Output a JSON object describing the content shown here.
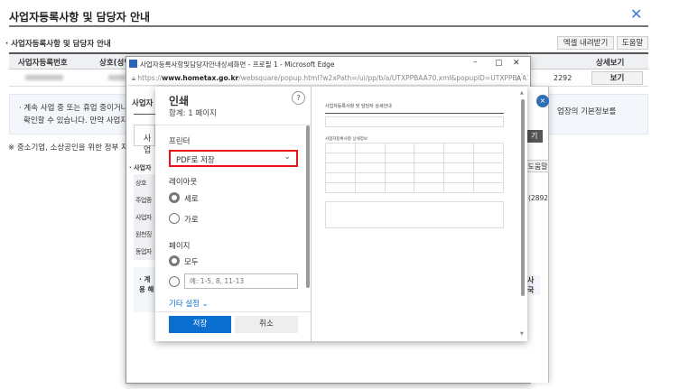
{
  "page": {
    "title": "사업자등록사항 및 담당자 안내",
    "section": "사업자등록사항 및 담당자 안내",
    "excel_btn": "엑셀 내려받기",
    "help_btn": "도움말",
    "columns": [
      "사업자등록번호",
      "상호(성명)",
      "",
      "",
      "",
      "",
      "",
      "상세보기"
    ],
    "row": {
      "tail_value": "2292",
      "view_btn": "보기"
    },
    "notice_1": "· 계속 사업 중 또는 휴업 중이거나 폐업한 사업장에 대해 사업장의 기본정보를",
    "notice_2": "확인할 수 있습니다. 만약 사업자...",
    "footnote": "※ 중소기업, 소상공인을 위한 정부 지..."
  },
  "detail_modal": {
    "title": "사업자",
    "tab": "사업",
    "section": "· 사업자",
    "help_btn": "도움말",
    "btn_dark": "기",
    "rows": [
      "상호",
      "주업종",
      "사업자",
      "원천징",
      "동업자"
    ],
    "value": "(2892",
    "notice": "· 계 용 해",
    "notice_r": "사 국"
  },
  "edge": {
    "title": "사업자등록사항및담당자안내상세화면 - 프로필 1 - Microsoft Edge",
    "url_prefix": "https://",
    "url_domain": "www.hometax.go.kr",
    "url_rest": "/websquare/popup.html?w2xPath=/ui/pp/b/a/UTXPPBAA70.xml&popupID=UTXPPBAA70&..."
  },
  "print": {
    "title": "인쇄",
    "total": "합계: 1 페이지",
    "printer_label": "프린터",
    "printer_value": "PDF로 저장",
    "layout_label": "레이아웃",
    "portrait": "세로",
    "landscape": "가로",
    "pages_label": "페이지",
    "all": "모두",
    "range_placeholder": "예: 1-5, 8, 11-13",
    "more": "기타 설정",
    "save": "저장",
    "cancel": "취소",
    "highlight_color": "#e8141c",
    "accent": "#0a6fcf"
  },
  "preview": {
    "title": "사업자등록사항 및 담당자 상세안내",
    "sub": "사업자등록사항 상세정보"
  }
}
